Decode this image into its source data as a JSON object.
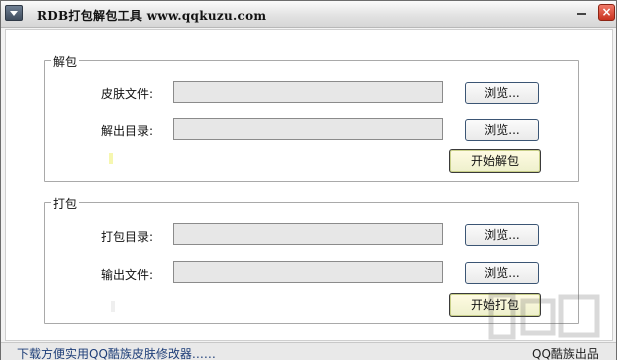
{
  "window": {
    "title": "RDB打包解包工具 www.qqkuzu.com"
  },
  "unpack": {
    "group_label": "解包",
    "skin_file_label": "皮肤文件:",
    "output_dir_label": "解出目录:",
    "skin_file_value": "",
    "output_dir_value": "",
    "browse1_label": "浏览...",
    "browse2_label": "浏览...",
    "start_label": "开始解包"
  },
  "pack": {
    "group_label": "打包",
    "pack_dir_label": "打包目录:",
    "output_file_label": "输出文件:",
    "pack_dir_value": "",
    "output_file_value": "",
    "browse1_label": "浏览...",
    "browse2_label": "浏览...",
    "start_label": "开始打包"
  },
  "status": {
    "left_text": "下载方便实用QQ酷族皮肤修改器……",
    "right_text": "QQ酷族出品"
  },
  "colors": {
    "close_red": "#c8321f",
    "field_gray": "#e7e7e7",
    "primary_button": "#eef0cc",
    "status_link_blue": "#1f3f79"
  },
  "icons": {
    "system_menu": "chevron-down-icon",
    "minimize": "minimize-icon",
    "close": "close-icon"
  }
}
